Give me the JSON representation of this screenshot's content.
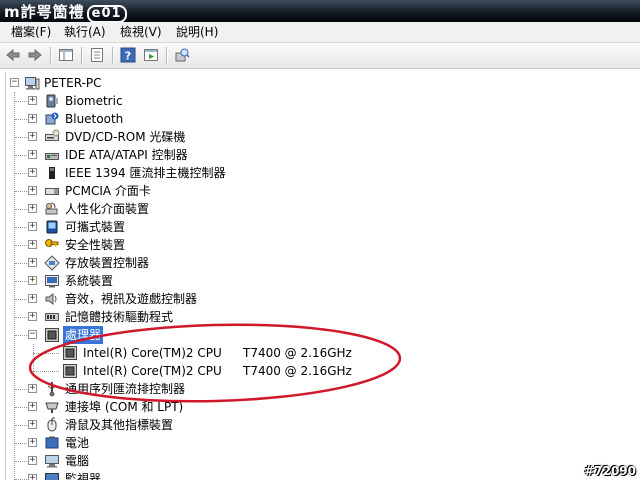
{
  "title_bar": {
    "logo_text": "m詐咢箇禮",
    "logo_badge": "e01"
  },
  "menu": [
    "檔案(F)",
    "執行(A)",
    "檢視(V)",
    "說明(H)"
  ],
  "toolbar": {
    "buttons": [
      "back-icon",
      "forward-icon",
      "show-hide-tree-icon",
      "properties-icon",
      "help-icon",
      "action-pane-icon",
      "scan-hardware-icon"
    ]
  },
  "tree": {
    "root": "PETER-PC",
    "nodes": [
      {
        "label": "Biometric",
        "icon": "biometric-icon"
      },
      {
        "label": "Bluetooth",
        "icon": "bluetooth-icon"
      },
      {
        "label": "DVD/CD-ROM 光碟機",
        "icon": "dvd-drive-icon"
      },
      {
        "label": "IDE ATA/ATAPI 控制器",
        "icon": "ide-controller-icon"
      },
      {
        "label": "IEEE 1394 匯流排主機控制器",
        "icon": "ieee1394-icon"
      },
      {
        "label": "PCMCIA 介面卡",
        "icon": "pcmcia-icon"
      },
      {
        "label": "人性化介面裝置",
        "icon": "hid-icon"
      },
      {
        "label": "可攜式裝置",
        "icon": "portable-device-icon"
      },
      {
        "label": "安全性裝置",
        "icon": "security-device-icon"
      },
      {
        "label": "存放裝置控制器",
        "icon": "storage-controller-icon"
      },
      {
        "label": "系統裝置",
        "icon": "system-device-icon"
      },
      {
        "label": "音效，視訊及遊戲控制器",
        "icon": "sound-icon"
      },
      {
        "label": "記憶體技術驅動程式",
        "icon": "memory-tech-icon"
      },
      {
        "label": "處理器",
        "icon": "processor-icon",
        "expanded": true,
        "selected": true
      },
      {
        "label": "通用序列匯流排控制器",
        "icon": "usb-controller-icon"
      },
      {
        "label": "連接埠 (COM 和 LPT)",
        "icon": "ports-icon"
      },
      {
        "label": "滑鼠及其他指標裝置",
        "icon": "mouse-icon"
      },
      {
        "label": "電池",
        "icon": "battery-icon"
      },
      {
        "label": "電腦",
        "icon": "computer-icon"
      },
      {
        "label": "監視器",
        "icon": "monitor-icon"
      }
    ],
    "processors": [
      {
        "name": "Intel(R) Core(TM)2 CPU",
        "model": "T7400  @ 2.16GHz"
      },
      {
        "name": "Intel(R) Core(TM)2 CPU",
        "model": "T7400  @ 2.16GHz"
      }
    ]
  },
  "watermark": "#72090"
}
